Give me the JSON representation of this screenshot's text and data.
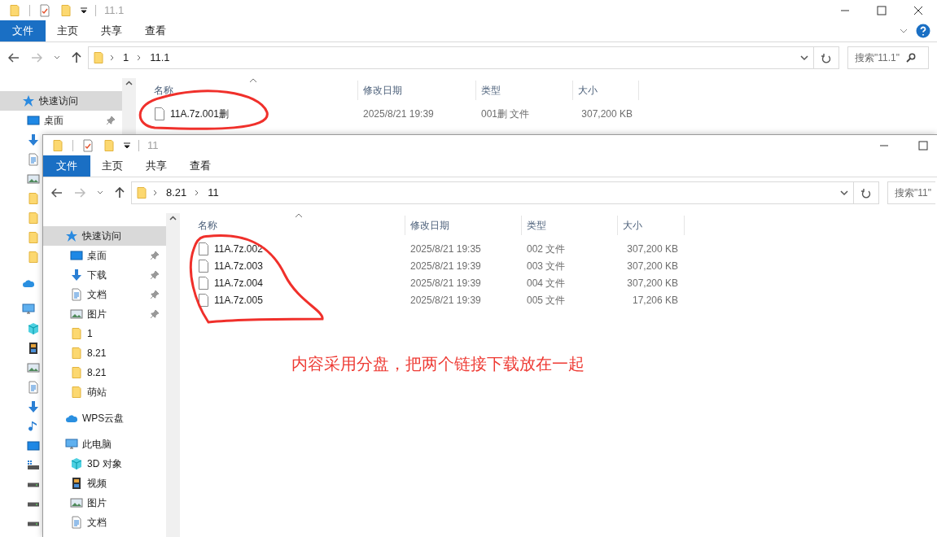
{
  "back_window": {
    "title": "11.1",
    "ribbon_tabs": [
      {
        "kind": "file_menu",
        "label": "文件"
      },
      {
        "kind": "tab",
        "label": "主页"
      },
      {
        "kind": "tab",
        "label": "共享"
      },
      {
        "kind": "tab",
        "label": "查看"
      }
    ],
    "path": [
      "1",
      "11.1"
    ],
    "search": {
      "placeholder": "搜索\"11.1\""
    },
    "nav": [
      {
        "kind": "star",
        "label": "快速访问",
        "selected": true,
        "children": [
          {
            "kind": "desktop",
            "label": "桌面",
            "selected": false,
            "pinned": true
          },
          {
            "kind": "download",
            "selected": false
          },
          {
            "kind": "doc",
            "selected": false
          },
          {
            "kind": "picture",
            "selected": false
          },
          {
            "kind": "folder",
            "selected": false
          },
          {
            "kind": "folder",
            "selected": false
          },
          {
            "kind": "folder",
            "selected": false
          },
          {
            "kind": "folder",
            "selected": false
          }
        ]
      },
      {
        "kind": "cloud",
        "selected": false
      },
      {
        "kind": "computer",
        "selected": false,
        "children": [
          {
            "kind": "cube",
            "selected": false
          },
          {
            "kind": "film",
            "selected": false
          },
          {
            "kind": "picture",
            "selected": false
          },
          {
            "kind": "doc",
            "selected": false
          },
          {
            "kind": "download",
            "selected": false
          },
          {
            "kind": "music",
            "selected": false
          },
          {
            "kind": "desktop",
            "selected": false
          },
          {
            "kind": "drive_win",
            "selected": false
          },
          {
            "kind": "drive",
            "selected": false
          },
          {
            "kind": "drive",
            "selected": false
          },
          {
            "kind": "drive",
            "selected": false
          }
        ]
      }
    ],
    "columns": [
      "名称",
      "修改日期",
      "类型",
      "大小"
    ],
    "rows": [
      {
        "name": "11A.7z.001删",
        "date": "2025/8/21 19:39",
        "type": "001删 文件",
        "size": "307,200 KB"
      }
    ]
  },
  "front_window": {
    "title": "11",
    "ribbon_tabs": [
      {
        "kind": "file_menu",
        "label": "文件"
      },
      {
        "kind": "tab",
        "label": "主页"
      },
      {
        "kind": "tab",
        "label": "共享"
      },
      {
        "kind": "tab",
        "label": "查看"
      }
    ],
    "path": [
      "8.21",
      "11"
    ],
    "search": {
      "placeholder": "搜索\"11\""
    },
    "nav": [
      {
        "kind": "star",
        "label": "快速访问",
        "selected": true,
        "children": [
          {
            "kind": "desktop",
            "label": "桌面",
            "selected": false,
            "pinned": true
          },
          {
            "kind": "download",
            "label": "下载",
            "selected": false,
            "pinned": true
          },
          {
            "kind": "doc",
            "label": "文档",
            "selected": false,
            "pinned": true
          },
          {
            "kind": "picture",
            "label": "图片",
            "selected": false,
            "pinned": true
          },
          {
            "kind": "folder",
            "label": "1",
            "selected": false,
            "pinned": false
          },
          {
            "kind": "folder",
            "label": "8.21",
            "selected": false,
            "pinned": false
          },
          {
            "kind": "folder",
            "label": "8.21",
            "selected": false,
            "pinned": false
          },
          {
            "kind": "folder",
            "label": "萌站",
            "selected": false,
            "pinned": false
          }
        ]
      },
      {
        "kind": "cloud",
        "label": "WPS云盘",
        "selected": false
      },
      {
        "kind": "computer",
        "label": "此电脑",
        "selected": false,
        "children": [
          {
            "kind": "cube",
            "label": "3D 对象",
            "selected": false
          },
          {
            "kind": "film",
            "label": "视频",
            "selected": false
          },
          {
            "kind": "picture",
            "label": "图片",
            "selected": false
          },
          {
            "kind": "doc",
            "label": "文档",
            "selected": false
          }
        ]
      }
    ],
    "columns": [
      "名称",
      "修改日期",
      "类型",
      "大小"
    ],
    "rows": [
      {
        "name": "11A.7z.002",
        "date": "2025/8/21 19:35",
        "type": "002 文件",
        "size": "307,200 KB"
      },
      {
        "name": "11A.7z.003",
        "date": "2025/8/21 19:39",
        "type": "003 文件",
        "size": "307,200 KB"
      },
      {
        "name": "11A.7z.004",
        "date": "2025/8/21 19:39",
        "type": "004 文件",
        "size": "307,200 KB"
      },
      {
        "name": "11A.7z.005",
        "date": "2025/8/21 19:39",
        "type": "005 文件",
        "size": "17,206 KB"
      }
    ]
  },
  "annotation": {
    "text": "内容采用分盘，把两个链接下载放在一起"
  }
}
